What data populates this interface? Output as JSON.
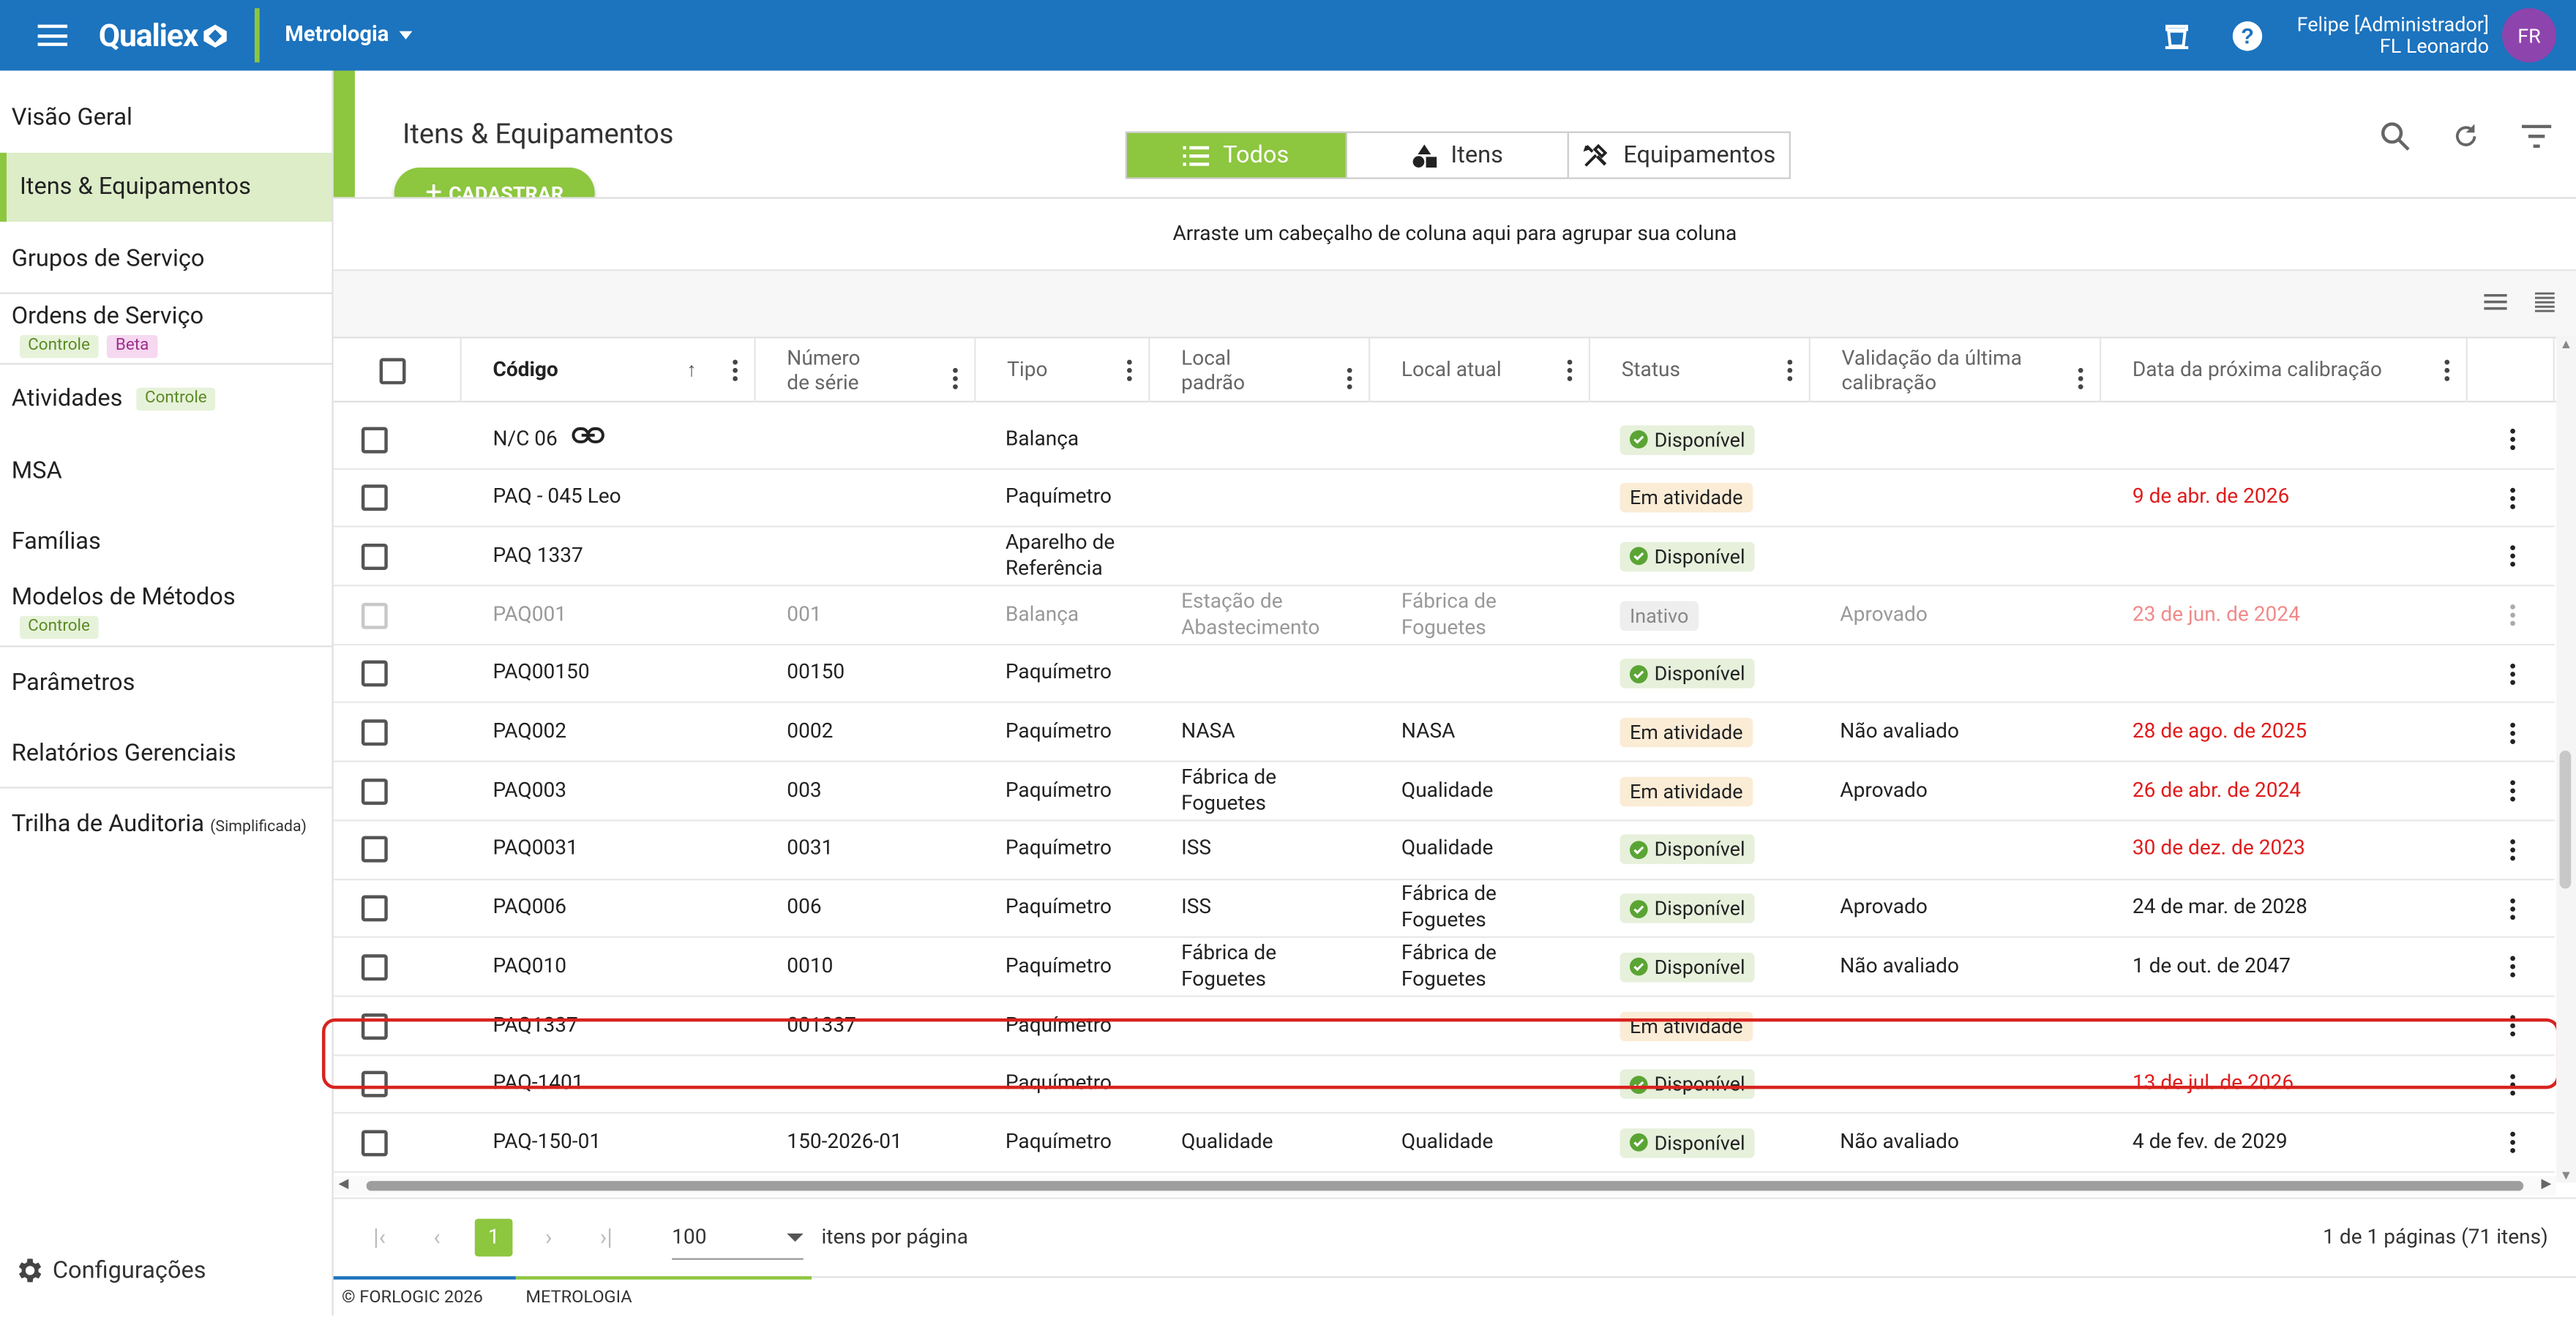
{
  "header": {
    "brand": "Qualiex",
    "module": "Metrologia",
    "user_name": "Felipe [Administrador]",
    "user_unit": "FL Leonardo",
    "avatar_initials": "FR"
  },
  "sidebar": {
    "items": [
      {
        "label": "Visão Geral"
      },
      {
        "label": "Itens & Equipamentos"
      },
      {
        "label": "Grupos de Serviço"
      },
      {
        "label": "Ordens de Serviço",
        "tags": [
          "Controle",
          "Beta"
        ]
      },
      {
        "label": "Atividades",
        "tags": [
          "Controle"
        ]
      },
      {
        "label": "MSA"
      },
      {
        "label": "Famílias"
      },
      {
        "label": "Modelos de Métodos",
        "tags": [
          "Controle"
        ]
      },
      {
        "label": "Parâmetros"
      },
      {
        "label": "Relatórios Gerenciais"
      },
      {
        "label": "Trilha de Auditoria",
        "suffix": "(Simplificada)"
      }
    ],
    "config_label": "Configurações"
  },
  "main": {
    "title": "Itens & Equipamentos",
    "add_button": "CADASTRAR",
    "view_toggle": [
      "Todos",
      "Itens",
      "Equipamentos"
    ],
    "group_hint": "Arraste um cabeçalho de coluna aqui para agrupar sua coluna"
  },
  "table": {
    "columns": [
      "Código",
      "Número de série",
      "Tipo",
      "Local padrão",
      "Local atual",
      "Status",
      "Validação da última calibração",
      "Data da próxima calibração"
    ],
    "rows": [
      {
        "codigo": "N/C 06",
        "serie": "",
        "tipo": "Balança",
        "local_padrao": "",
        "local_atual": "",
        "status": "Disponível",
        "validacao": "",
        "proxima": "",
        "link": true
      },
      {
        "codigo": "PAQ - 045 Leo",
        "serie": "",
        "tipo": "Paquímetro",
        "local_padrao": "",
        "local_atual": "",
        "status": "Em atividade",
        "validacao": "",
        "proxima": "9 de abr. de 2026",
        "overdue": true
      },
      {
        "codigo": "PAQ 1337",
        "serie": "",
        "tipo": "Aparelho de Referência",
        "local_padrao": "",
        "local_atual": "",
        "status": "Disponível",
        "validacao": "",
        "proxima": ""
      },
      {
        "codigo": "PAQ001",
        "serie": "001",
        "tipo": "Balança",
        "local_padrao": "Estação de Abastecimento",
        "local_atual": "Fábrica de Foguetes",
        "status": "Inativo",
        "validacao": "Aprovado",
        "proxima": "23 de jun. de 2024",
        "overdue": true,
        "inactive": true
      },
      {
        "codigo": "PAQ00150",
        "serie": "00150",
        "tipo": "Paquímetro",
        "local_padrao": "",
        "local_atual": "",
        "status": "Disponível",
        "validacao": "",
        "proxima": ""
      },
      {
        "codigo": "PAQ002",
        "serie": "0002",
        "tipo": "Paquímetro",
        "local_padrao": "NASA",
        "local_atual": "NASA",
        "status": "Em atividade",
        "validacao": "Não avaliado",
        "proxima": "28 de ago. de 2025",
        "overdue": true
      },
      {
        "codigo": "PAQ003",
        "serie": "003",
        "tipo": "Paquímetro",
        "local_padrao": "Fábrica de Foguetes",
        "local_atual": "Qualidade",
        "status": "Em atividade",
        "validacao": "Aprovado",
        "proxima": "26 de abr. de 2024",
        "overdue": true
      },
      {
        "codigo": "PAQ0031",
        "serie": "0031",
        "tipo": "Paquímetro",
        "local_padrao": "ISS",
        "local_atual": "Qualidade",
        "status": "Disponível",
        "validacao": "",
        "proxima": "30 de dez. de 2023",
        "overdue": true
      },
      {
        "codigo": "PAQ006",
        "serie": "006",
        "tipo": "Paquímetro",
        "local_padrao": "ISS",
        "local_atual": "Fábrica de Foguetes",
        "status": "Disponível",
        "validacao": "Aprovado",
        "proxima": "24 de mar. de 2028"
      },
      {
        "codigo": "PAQ010",
        "serie": "0010",
        "tipo": "Paquímetro",
        "local_padrao": "Fábrica de Foguetes",
        "local_atual": "Fábrica de Foguetes",
        "status": "Disponível",
        "validacao": "Não avaliado",
        "proxima": "1 de out. de 2047"
      },
      {
        "codigo": "PAQ1337",
        "serie": "001337",
        "tipo": "Paquímetro",
        "local_padrao": "",
        "local_atual": "",
        "status": "Em atividade",
        "validacao": "",
        "proxima": ""
      },
      {
        "codigo": "PAQ-1401",
        "serie": "",
        "tipo": "Paquímetro",
        "local_padrao": "",
        "local_atual": "",
        "status": "Disponível",
        "validacao": "",
        "proxima": "13 de jul. de 2026",
        "overdue": true
      },
      {
        "codigo": "PAQ-150-01",
        "serie": "150-2026-01",
        "tipo": "Paquímetro",
        "local_padrao": "Qualidade",
        "local_atual": "Qualidade",
        "status": "Disponível",
        "validacao": "Não avaliado",
        "proxima": "4 de fev. de 2029"
      }
    ]
  },
  "pager": {
    "current_page": "1",
    "page_size": "100",
    "per_page_label": "itens por página",
    "info": "1 de 1 páginas (71 itens)"
  },
  "footer": {
    "copyright": "© FORLOGIC 2026",
    "module": "METROLOGIA"
  },
  "colors": {
    "primary": "#1c73be",
    "accent": "#8dc63f",
    "overdue": "#e01b1b"
  }
}
